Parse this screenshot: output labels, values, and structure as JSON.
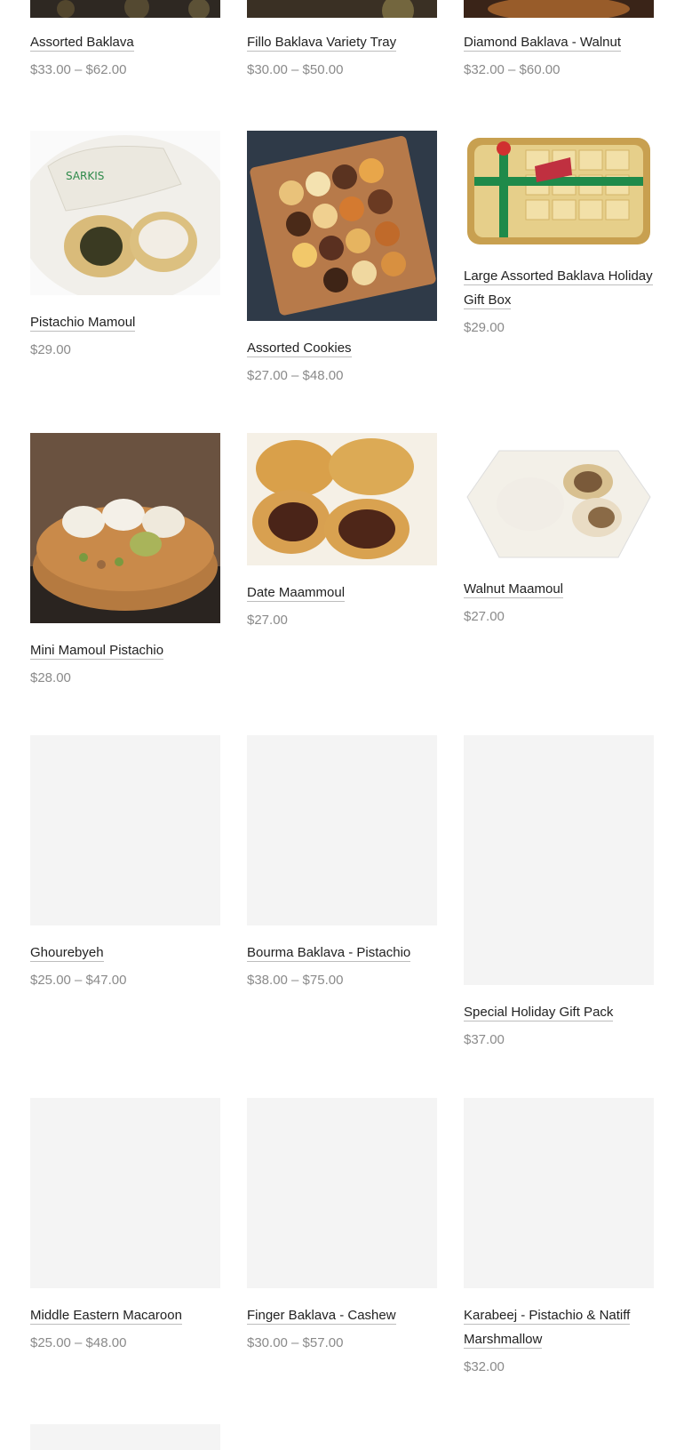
{
  "products": [
    {
      "title": "Assorted Baklava",
      "price": "$33.00 – $62.00",
      "image": "baklava-photo"
    },
    {
      "title": "Fillo Baklava Variety Tray",
      "price": "$30.00 – $50.00",
      "image": "baklava-tray-photo"
    },
    {
      "title": "Diamond Baklava - Walnut",
      "price": "$32.00 – $60.00",
      "image": "diamond-baklava-photo"
    },
    {
      "title": "Pistachio Mamoul",
      "price": "$29.00",
      "image": "pistachio-mamoul-photo"
    },
    {
      "title": "Assorted Cookies",
      "price": "$27.00 – $48.00",
      "image": "assorted-cookies-photo"
    },
    {
      "title": "Large Assorted Baklava Holiday Gift Box",
      "price": "$29.00",
      "image": "gift-box-photo"
    },
    {
      "title": "Mini Mamoul Pistachio",
      "price": "$28.00",
      "image": "mini-mamoul-photo"
    },
    {
      "title": "Date Maammoul",
      "price": "$27.00",
      "image": "date-maammoul-photo"
    },
    {
      "title": "Walnut Maamoul",
      "price": "$27.00",
      "image": "walnut-maamoul-photo"
    },
    {
      "title": "Ghourebyeh",
      "price": "$25.00 – $47.00",
      "image": "image-placeholder"
    },
    {
      "title": "Bourma Baklava - Pistachio",
      "price": "$38.00 – $75.00",
      "image": "image-placeholder"
    },
    {
      "title": "Special Holiday Gift Pack",
      "price": "$37.00",
      "image": "image-placeholder"
    },
    {
      "title": "Middle Eastern Macaroon",
      "price": "$25.00 – $48.00",
      "image": "image-placeholder"
    },
    {
      "title": "Finger Baklava - Cashew",
      "price": "$30.00 – $57.00",
      "image": "image-placeholder"
    },
    {
      "title": "Karabeej - Pistachio & Natiff Marshmallow",
      "price": "$32.00",
      "image": "image-placeholder"
    }
  ],
  "colors": {
    "placeholder": "#f4f4f4",
    "price": "#8a8a8a",
    "title": "#222222"
  }
}
